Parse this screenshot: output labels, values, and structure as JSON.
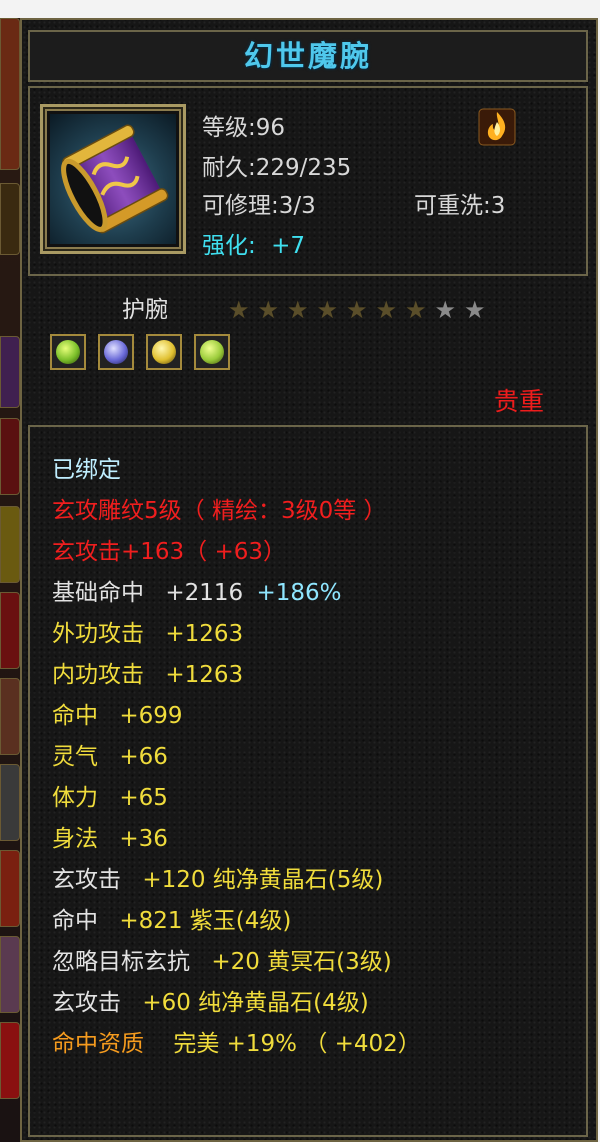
{
  "item": {
    "name": "幻世魔腕",
    "level": "等级:96",
    "durability": "耐久:229/235",
    "repairable": "可修理:3/3",
    "rewash": "可重洗:3",
    "strengthen_label": "强化:",
    "strengthen_value": "+7",
    "type": "护腕",
    "rarity": "贵重",
    "stars_total": 9,
    "stars_lit": 7
  },
  "gems": [
    {
      "name": "gem-slot-1",
      "color": "#7bbf2a"
    },
    {
      "name": "gem-slot-2",
      "color": "#6a6ad8"
    },
    {
      "name": "gem-slot-3",
      "color": "#e0c030"
    },
    {
      "name": "gem-slot-4",
      "color": "#9acb3a"
    }
  ],
  "desc": {
    "bound": "已绑定",
    "carve": "玄攻雕纹5级（ 精绘：3级0等 ）",
    "xuan_attack": "玄攻击+163（ +63）",
    "base_hit_label": "基础命中",
    "base_hit_value": "+2116",
    "base_hit_pct": "+186%",
    "outer_attack": "外功攻击",
    "outer_attack_value": "+1263",
    "inner_attack": "内功攻击",
    "inner_attack_value": "+1263",
    "hit": "命中",
    "hit_value": "+699",
    "spirit": "灵气",
    "spirit_value": "+66",
    "stamina": "体力",
    "stamina_value": "+65",
    "agility": "身法",
    "agility_value": "+36",
    "gem1_attr": "玄攻击",
    "gem1_value": "+120 纯净黄晶石(5级)",
    "gem2_attr": "命中",
    "gem2_value": "+821 紫玉(4级)",
    "gem3_attr": "忽略目标玄抗",
    "gem3_value": "+20 黄冥石(3级)",
    "gem4_attr": "玄攻击",
    "gem4_value": "+60 纯净黄晶石(4级)",
    "aptitude_label": "命中资质",
    "aptitude_value": "完美 +19% （ +402）"
  }
}
